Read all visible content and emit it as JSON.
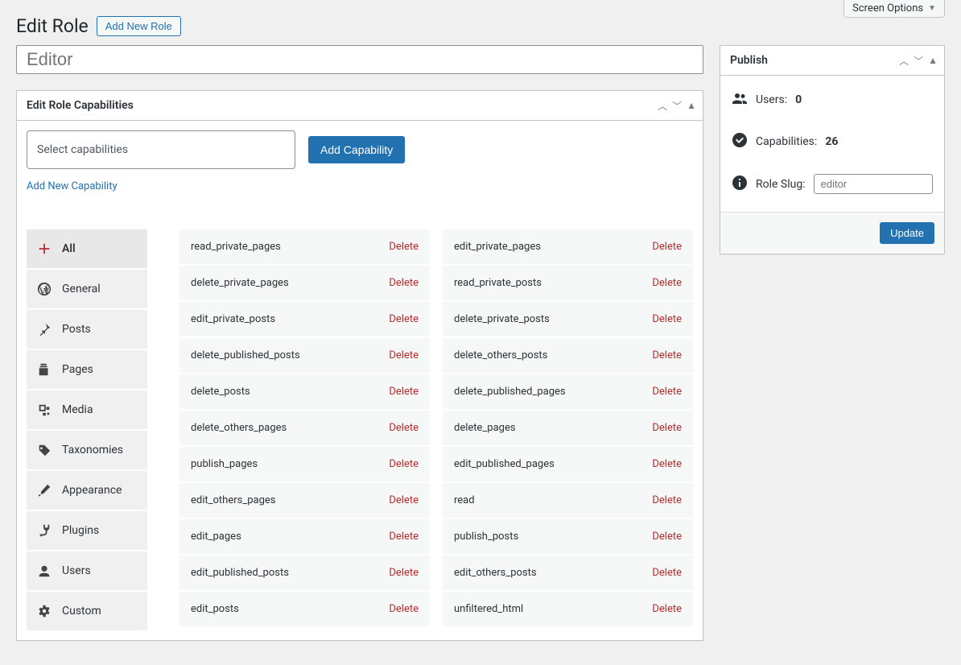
{
  "screen_options": "Screen Options",
  "page": {
    "title": "Edit Role",
    "add_button": "Add New Role"
  },
  "role_name_placeholder": "Editor",
  "capabilities_box": {
    "title": "Edit Role Capabilities",
    "select_placeholder": "Select capabilities",
    "add_cap_button": "Add Capability",
    "add_new_cap_link": "Add New Capability",
    "delete_label": "Delete"
  },
  "tabs": [
    {
      "key": "all",
      "label": "All",
      "active": true
    },
    {
      "key": "general",
      "label": "General"
    },
    {
      "key": "posts",
      "label": "Posts"
    },
    {
      "key": "pages",
      "label": "Pages"
    },
    {
      "key": "media",
      "label": "Media"
    },
    {
      "key": "taxonomies",
      "label": "Taxonomies"
    },
    {
      "key": "appearance",
      "label": "Appearance"
    },
    {
      "key": "plugins",
      "label": "Plugins"
    },
    {
      "key": "users",
      "label": "Users"
    },
    {
      "key": "custom",
      "label": "Custom"
    }
  ],
  "caps_left": [
    "read_private_pages",
    "delete_private_pages",
    "edit_private_posts",
    "delete_published_posts",
    "delete_posts",
    "delete_others_pages",
    "publish_pages",
    "edit_others_pages",
    "edit_pages",
    "edit_published_posts",
    "edit_posts"
  ],
  "caps_right": [
    "edit_private_pages",
    "read_private_posts",
    "delete_private_posts",
    "delete_others_posts",
    "delete_published_pages",
    "delete_pages",
    "edit_published_pages",
    "read",
    "publish_posts",
    "edit_others_posts",
    "unfiltered_html"
  ],
  "publish": {
    "title": "Publish",
    "users_label": "Users:",
    "users_count": "0",
    "caps_label": "Capabilities:",
    "caps_count": "26",
    "slug_label": "Role Slug:",
    "slug_placeholder": "editor",
    "update_button": "Update"
  }
}
